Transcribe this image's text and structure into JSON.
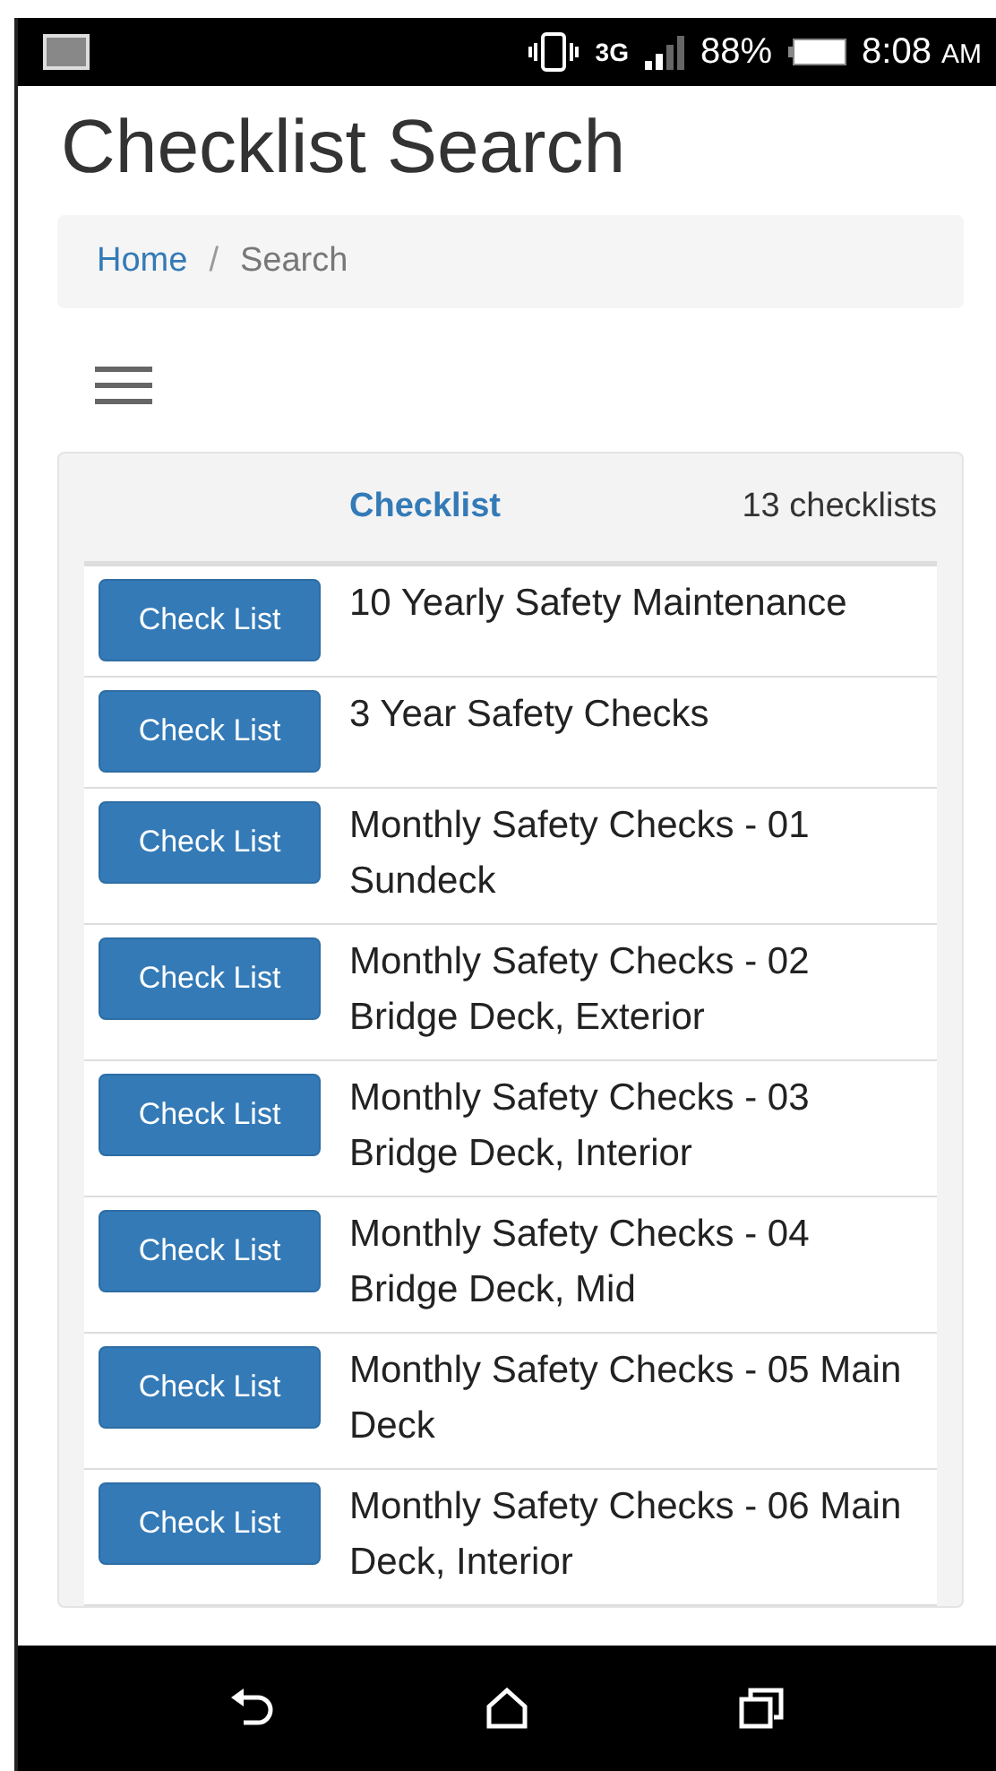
{
  "status_bar": {
    "battery_text": "88%",
    "time": "8:08",
    "time_suffix": "AM",
    "network": "3G"
  },
  "page_title": "Checklist Search",
  "breadcrumb_separator": "/",
  "breadcrumb": [
    {
      "label": "Home",
      "kind": "link"
    },
    {
      "label": "Search",
      "kind": "current"
    }
  ],
  "panel": {
    "column_header": "Checklist",
    "count": "13 checklists",
    "rows": [
      {
        "button": "Check List",
        "name": "10 Yearly Safety Maintenance"
      },
      {
        "button": "Check List",
        "name": "3 Year Safety Checks"
      },
      {
        "button": "Check List",
        "name": "Monthly Safety Checks - 01 Sundeck"
      },
      {
        "button": "Check List",
        "name": "Monthly Safety Checks - 02 Bridge Deck, Exterior"
      },
      {
        "button": "Check List",
        "name": "Monthly Safety Checks - 03 Bridge Deck, Interior"
      },
      {
        "button": "Check List",
        "name": "Monthly Safety Checks - 04 Bridge Deck, Mid"
      },
      {
        "button": "Check List",
        "name": "Monthly Safety Checks - 05 Main Deck"
      },
      {
        "button": "Check List",
        "name": "Monthly Safety Checks - 06 Main Deck, Interior"
      }
    ]
  }
}
